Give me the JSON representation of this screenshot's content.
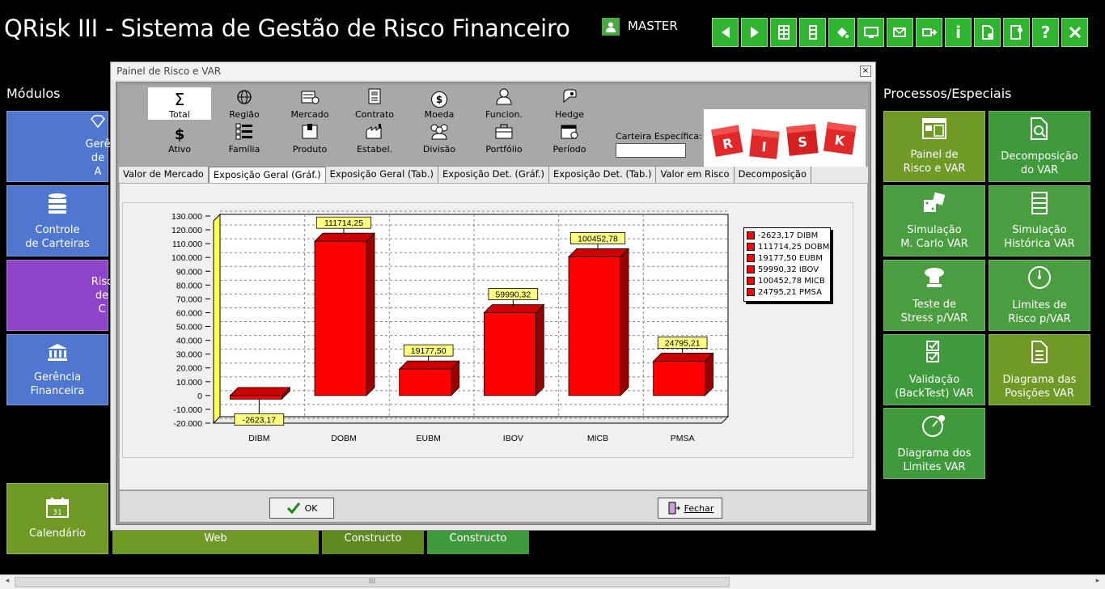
{
  "app": {
    "title": "QRisk III - Sistema de Gestão de Risco Financeiro",
    "user": "MASTER"
  },
  "topbar": {
    "icons": [
      "arrow-left-icon",
      "arrow-right-icon",
      "grid-icon",
      "column-icon",
      "paint-bucket-icon",
      "monitor-icon",
      "mail-check-icon",
      "export-icon",
      "info-icon",
      "document-settings-icon",
      "config-icon",
      "help-icon",
      "close-icon"
    ],
    "info_glyph": "i",
    "help_glyph": "?"
  },
  "sections": {
    "modulos": "Módulos",
    "processos": "Processos/Especiais"
  },
  "left_tiles": [
    {
      "label1": "Gerê",
      "label2": "de A"
    },
    {
      "label1": "Controle",
      "label2": "de Carteiras"
    },
    {
      "label1": "Risc",
      "label2": "de  C"
    },
    {
      "label1": "Gerência",
      "label2": "Financeira"
    },
    {
      "label1": "Calendário",
      "label2": ""
    }
  ],
  "right_tiles": [
    {
      "label1": "Painel de",
      "label2": "Risco e VAR"
    },
    {
      "label1": "Decomposição",
      "label2": "do VAR"
    },
    {
      "label1": "Simulação",
      "label2": "M. Carlo VAR"
    },
    {
      "label1": "Simulação",
      "label2": "Histórica VAR"
    },
    {
      "label1": "Teste de",
      "label2": "Stress p/VAR"
    },
    {
      "label1": "Limites de",
      "label2": "Risco p/VAR"
    },
    {
      "label1": "Validação",
      "label2": "(BackTest) VAR"
    },
    {
      "label1": "Diagrama das",
      "label2": "Posições VAR"
    },
    {
      "label1": "Diagrama dos",
      "label2": "Limites VAR"
    }
  ],
  "bottom_tiles": [
    "Web",
    "Constructo",
    "Constructo"
  ],
  "calendar_day": "31",
  "dialog": {
    "title": "Painel de Risco e VAR",
    "close": "×",
    "toolbar": [
      {
        "label": "Total",
        "icon": "sigma-icon",
        "glyph": "Σ"
      },
      {
        "label": "Região",
        "icon": "globe-icon"
      },
      {
        "label": "Mercado",
        "icon": "market-icon"
      },
      {
        "label": "Contrato",
        "icon": "contract-icon"
      },
      {
        "label": "Moeda",
        "icon": "coin-icon",
        "glyph": "$"
      },
      {
        "label": "Funcion.",
        "icon": "employee-icon"
      },
      {
        "label": "Hedge",
        "icon": "hedge-icon"
      },
      {
        "label": "Ativo",
        "icon": "asset-icon",
        "glyph": "$"
      },
      {
        "label": "Família",
        "icon": "list-icon"
      },
      {
        "label": "Produto",
        "icon": "product-icon"
      },
      {
        "label": "Estabel.",
        "icon": "factory-icon"
      },
      {
        "label": "Divisão",
        "icon": "group-icon"
      },
      {
        "label": "Portfólio",
        "icon": "portfolio-icon"
      },
      {
        "label": "Período",
        "icon": "calendar-icon"
      }
    ],
    "carteira_label": "Carteira Específica:",
    "carteira_value": "",
    "risk_letters": [
      "R",
      "I",
      "S",
      "K"
    ],
    "tabs": [
      "Valor de Mercado",
      "Exposição Geral (Gráf.)",
      "Exposição Geral (Tab.)",
      "Exposição Det. (Gráf.)",
      "Exposição Det. (Tab.)",
      "Valor em Risco",
      "Decomposição"
    ],
    "active_tab": 1,
    "ok_label": "OK",
    "fechar_label": "Fechar"
  },
  "chart_data": {
    "type": "bar",
    "categories": [
      "DIBM",
      "DOBM",
      "EUBM",
      "IBOV",
      "MICB",
      "PMSA"
    ],
    "values": [
      -2623.17,
      111714.25,
      19177.5,
      59990.32,
      100452.78,
      24795.21
    ],
    "value_labels": [
      "-2623,17",
      "111714,25",
      "19177,50",
      "59990,32",
      "100452,78",
      "24795,21"
    ],
    "ticks": [
      "130.000",
      "120.000",
      "110.000",
      "100.000",
      "90.000",
      "80.000",
      "70.000",
      "60.000",
      "50.000",
      "40.000",
      "30.000",
      "20.000",
      "10.000",
      "0",
      "-10.000",
      "-20.000"
    ],
    "legend": [
      "-2623,17 DIBM",
      "111714,25 DOBM",
      "19177,50 EUBM",
      "59990,32 IBOV",
      "100452,78 MICB",
      "24795,21 PMSA"
    ],
    "ylim": [
      -20000,
      130000
    ],
    "grid": true,
    "legend_position": "right",
    "bar_color": "#ff0000",
    "bar_side_color": "#990000",
    "label_bg": "#ffff80"
  }
}
